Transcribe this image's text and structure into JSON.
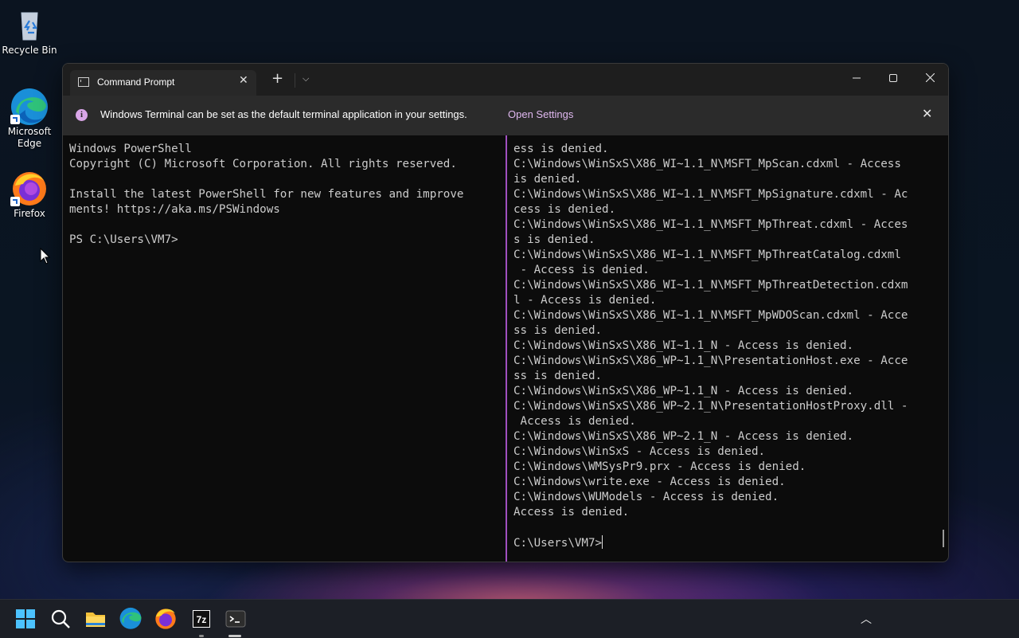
{
  "desktop": {
    "icons": [
      {
        "label": "Recycle Bin"
      },
      {
        "label": "Microsoft\nEdge"
      },
      {
        "label": "Firefox"
      }
    ]
  },
  "terminal": {
    "tab_title": "Command Prompt",
    "new_tab_label": "+",
    "infobar": {
      "message": "Windows Terminal can be set as the default terminal application in your settings.",
      "link": "Open Settings"
    },
    "left_pane": [
      "Windows PowerShell",
      "Copyright (C) Microsoft Corporation. All rights reserved.",
      "",
      "Install the latest PowerShell for new features and improve",
      "ments! https://aka.ms/PSWindows",
      "",
      "PS C:\\Users\\VM7>"
    ],
    "right_pane": [
      "ess is denied.",
      "C:\\Windows\\WinSxS\\X86_WI~1.1_N\\MSFT_MpScan.cdxml - Access",
      "is denied.",
      "C:\\Windows\\WinSxS\\X86_WI~1.1_N\\MSFT_MpSignature.cdxml - Ac",
      "cess is denied.",
      "C:\\Windows\\WinSxS\\X86_WI~1.1_N\\MSFT_MpThreat.cdxml - Acces",
      "s is denied.",
      "C:\\Windows\\WinSxS\\X86_WI~1.1_N\\MSFT_MpThreatCatalog.cdxml",
      " - Access is denied.",
      "C:\\Windows\\WinSxS\\X86_WI~1.1_N\\MSFT_MpThreatDetection.cdxm",
      "l - Access is denied.",
      "C:\\Windows\\WinSxS\\X86_WI~1.1_N\\MSFT_MpWDOScan.cdxml - Acce",
      "ss is denied.",
      "C:\\Windows\\WinSxS\\X86_WI~1.1_N - Access is denied.",
      "C:\\Windows\\WinSxS\\X86_WP~1.1_N\\PresentationHost.exe - Acce",
      "ss is denied.",
      "C:\\Windows\\WinSxS\\X86_WP~1.1_N - Access is denied.",
      "C:\\Windows\\WinSxS\\X86_WP~2.1_N\\PresentationHostProxy.dll -",
      " Access is denied.",
      "C:\\Windows\\WinSxS\\X86_WP~2.1_N - Access is denied.",
      "C:\\Windows\\WinSxS - Access is denied.",
      "C:\\Windows\\WMSysPr9.prx - Access is denied.",
      "C:\\Windows\\write.exe - Access is denied.",
      "C:\\Windows\\WUModels - Access is denied.",
      "Access is denied.",
      ""
    ],
    "right_prompt": "C:\\Users\\VM7>"
  },
  "taskbar": {
    "items": [
      "start-icon",
      "search-icon",
      "file-explorer-icon",
      "edge-icon",
      "firefox-icon",
      "7zip-icon",
      "terminal-icon"
    ],
    "seven_zip_text": "7z"
  },
  "colors": {
    "pane_divider": "#a050c0",
    "info_accent": "#d9a6e8",
    "link": "#e0b8f0"
  }
}
